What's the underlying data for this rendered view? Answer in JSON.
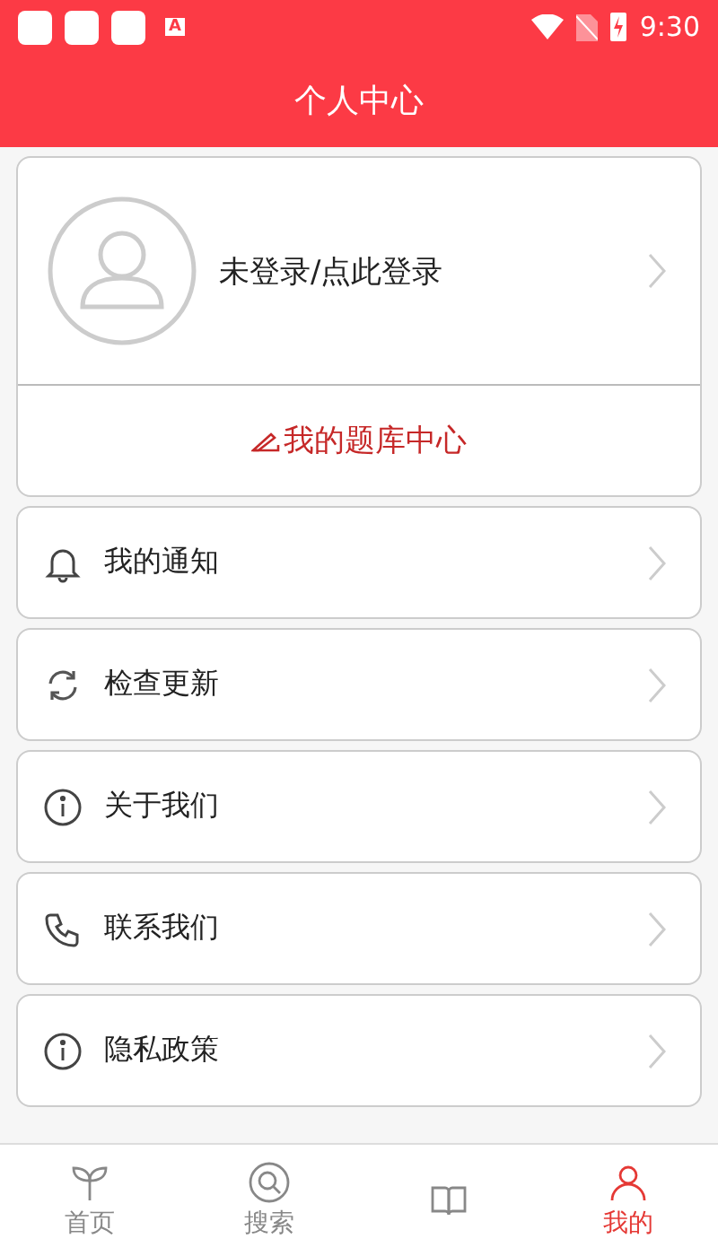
{
  "status_bar": {
    "time": "9:30",
    "notification_icons": [
      "A"
    ]
  },
  "header": {
    "title": "个人中心"
  },
  "profile": {
    "login_text": "未登录/点此登录",
    "question_bank_link": "我的题库中心"
  },
  "menu": [
    {
      "kind": "bell",
      "label": "我的通知"
    },
    {
      "kind": "refresh",
      "label": "检查更新"
    },
    {
      "kind": "info",
      "label": "关于我们"
    },
    {
      "kind": "phone",
      "label": "联系我们"
    },
    {
      "kind": "info",
      "label": "隐私政策"
    }
  ],
  "tabs": [
    {
      "kind": "sprout",
      "label": "首页",
      "selected": false
    },
    {
      "kind": "search",
      "label": "搜索",
      "selected": false
    },
    {
      "kind": "book",
      "selected": false
    },
    {
      "kind": "person",
      "label": "我的",
      "selected": true
    }
  ]
}
